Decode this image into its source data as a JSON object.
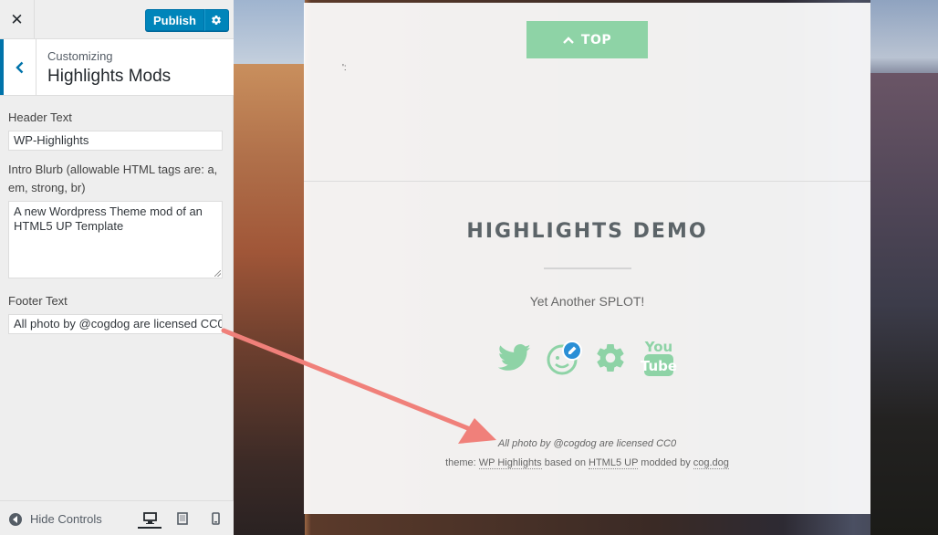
{
  "customizer": {
    "close_label": "✕",
    "publish_label": "Publish",
    "section_sub": "Customizing",
    "section_title": "Highlights Mods",
    "fields": {
      "header_label": "Header Text",
      "header_value": "WP-Highlights",
      "intro_label": "Intro Blurb (allowable HTML tags are: a, em, strong, br)",
      "intro_value": "A new Wordpress Theme mod of an HTML5 UP Template",
      "footer_label": "Footer Text",
      "footer_value": "All photo by @cogdog are licensed CC0"
    },
    "hide_controls": "Hide Controls"
  },
  "preview": {
    "top_button": "TOP",
    "site_title": "HIGHLIGHTS DEMO",
    "tagline": "Yet Another SPLOT!",
    "social_icons": [
      "twitter-icon",
      "splot-avatar-icon",
      "gear-icon",
      "youtube-icon"
    ],
    "credit": "All photo by @cogdog are licensed CC0",
    "theme_prefix": "theme: ",
    "theme_link": "WP Highlights",
    "based_on": " based on ",
    "html5_link": "HTML5 UP",
    "modded_by": " modded by ",
    "cogdog_link": "cog.dog",
    "youtube_label": "You Tube"
  },
  "colors": {
    "accent_green": "#8ed3a6",
    "publish_blue": "#0085ba",
    "annotation_arrow": "#f0807a"
  }
}
